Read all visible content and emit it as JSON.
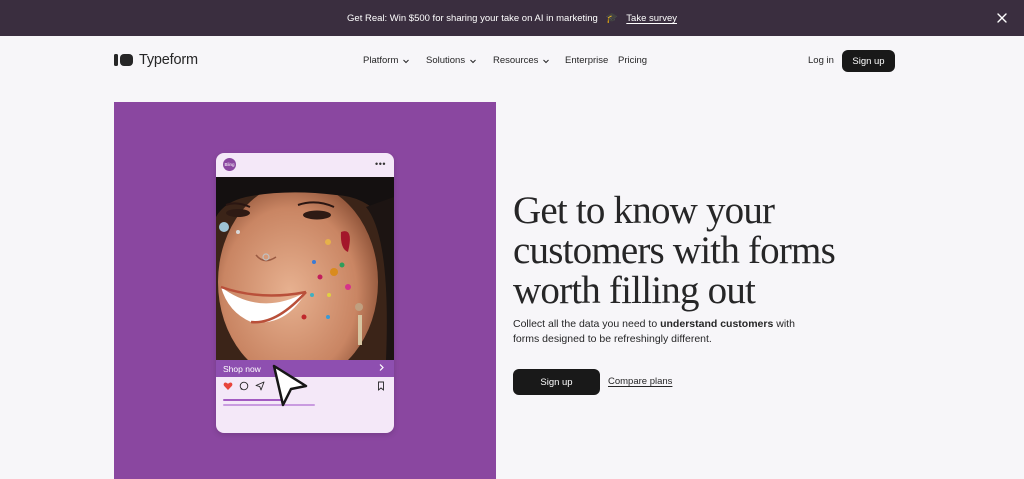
{
  "announcement": {
    "text": "Get Real: Win $500 for sharing your take on AI in marketing",
    "emoji": "🎓",
    "link_label": "Take survey",
    "close_icon": "close-icon"
  },
  "header": {
    "brand": "Typeform",
    "nav": {
      "platform": "Platform",
      "solutions": "Solutions",
      "resources": "Resources",
      "enterprise": "Enterprise",
      "pricing": "Pricing"
    },
    "login_label": "Log in",
    "signup_label": "Sign up"
  },
  "hero": {
    "headline": "Get to know your customers with forms worth filling out",
    "subcopy_pre": "Collect all the data you need to ",
    "subcopy_bold": "understand customers",
    "subcopy_post": " with forms designed to be refreshingly different.",
    "primary_cta": "Sign up",
    "secondary_cta": "Compare plans",
    "panel_color": "#8a47a0"
  },
  "phone_mockup": {
    "avatar_text": "Bling",
    "cta_label": "Shop now",
    "icons": [
      "heart-icon",
      "comment-icon",
      "share-icon",
      "bookmark-icon"
    ]
  }
}
